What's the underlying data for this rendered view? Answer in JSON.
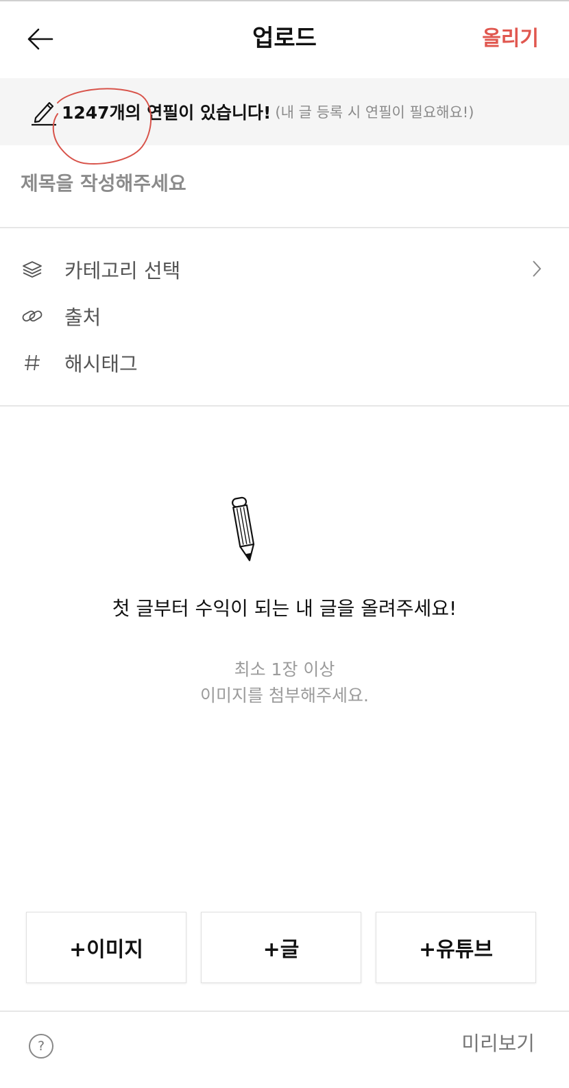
{
  "header": {
    "title": "업로드",
    "upload_label": "올리기",
    "accent_color": "#e0574f"
  },
  "pencil_banner": {
    "icon": "pencil-icon",
    "main_text": "1247개의 연필이 있습니다!",
    "sub_text": "(내 글 등록 시 연필이 필요해요!)"
  },
  "title_field": {
    "placeholder": "제목을 작성해주세요",
    "value": ""
  },
  "menu": {
    "items": [
      {
        "icon": "layers-icon",
        "label": "카테고리 선택",
        "has_chevron": true
      },
      {
        "icon": "link-icon",
        "label": "출처"
      },
      {
        "icon": "hashtag-icon",
        "label": "해시태그"
      }
    ]
  },
  "empty_state": {
    "icon": "pencil-icon",
    "title": "첫 글부터 수익이 되는 내 글을 올려주세요!",
    "subtitle_line1": "최소 1장 이상",
    "subtitle_line2": "이미지를 첨부해주세요."
  },
  "add_buttons": {
    "image_label": "+이미지",
    "text_label": "+글",
    "youtube_label": "+유튜브"
  },
  "bottom_bar": {
    "help_icon": "help-icon",
    "help_label": "?",
    "preview_label": "미리보기"
  }
}
